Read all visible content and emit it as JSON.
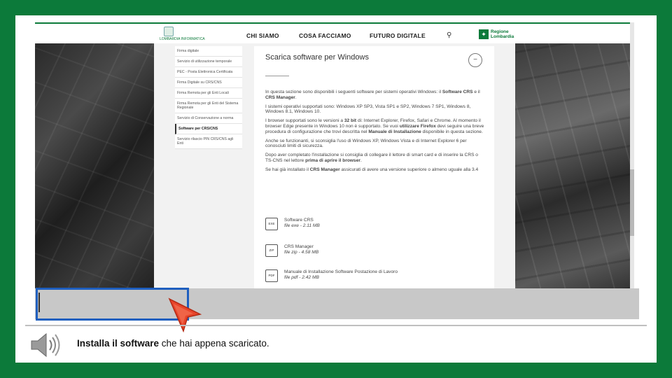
{
  "site": {
    "logo_text": "LOMBARDIA INFORMATICA",
    "nav": [
      "CHI SIAMO",
      "COSA FACCIAMO",
      "FUTURO DIGITALE"
    ],
    "search_icon": "search-icon",
    "region_line1": "Regione",
    "region_line2": "Lombardia"
  },
  "sidebar": {
    "items": [
      {
        "label": "Firma digitale"
      },
      {
        "label": "Servizio di utilizzazione temporale"
      },
      {
        "label": "PEC - Posta Elettronica Certificata"
      },
      {
        "label": "Firma Digitale su CRS/CNS"
      },
      {
        "label": "Firma Remota per gli Enti Locali"
      },
      {
        "label": "Firma Remota per gli Enti del Sistema Regionale"
      },
      {
        "label": "Servizio di Conservazione a norma"
      },
      {
        "label": "Software per CRS/CNS",
        "active": true
      },
      {
        "label": "Servizio rilascio PIN CRS/CNS agli Enti"
      }
    ]
  },
  "content": {
    "title": "Scarica software per Windows",
    "collapse_symbol": "−",
    "p1_a": "In questa sezione sono disponibili i seguenti software per sistemi operativi Windows: il ",
    "p1_b": "Software CRS",
    "p1_c": " e il ",
    "p1_d": "CRS Manager",
    "p1_e": ".",
    "p2": "I sistemi operativi supportati sono: Windows XP SP3, Vista SP1 e SP2, Windows 7 SP1, Windows 8, Windows 8.1, Windows 10.",
    "p3_a": "I browser supportati sono le versioni a ",
    "p3_b": "32 bit",
    "p3_c": " di: Internet Explorer, Firefox, Safari e Chrome. Al momento il browser Edge presente in Windows 10 non è supportato. Se vuoi ",
    "p3_d": "utilizzare Firefox",
    "p3_e": " devi seguire una breve procedura di configurazione che trovi descritta nel ",
    "p3_f": "Manuale di Installazione",
    "p3_g": " disponibile in questa sezione.",
    "p4": "Anche se funzionanti, si sconsiglia l'uso di Windows XP, Windows Vista e di Internet Explorer 6 per conosciuti limiti di sicurezza.",
    "p5_a": "Dopo aver completato l'installazione si consiglia di collegare il lettore di smart card e di inserire la CRS o TS-CNS nel lettore ",
    "p5_b": "prima di aprire il browser",
    "p5_c": ".",
    "p6_a": "Se hai già installato il ",
    "p6_b": "CRS Manager",
    "p6_c": " assicurati di avere una versione superiore o almeno uguale alla 3.4",
    "downloads": [
      {
        "icon": "EXE",
        "name": "Software CRS",
        "meta": "file exe - 2.11 MB"
      },
      {
        "icon": "ZIP",
        "name": "CRS Manager",
        "meta": "file zip - 4.58 MB"
      },
      {
        "icon": "PDF",
        "name": "Manuale di Installazione Software Postazione di Lavoro",
        "meta": "file pdf - 2.42 MB"
      }
    ]
  },
  "caption": {
    "bold": "Installa il software",
    "rest": " che hai appena scaricato."
  },
  "colors": {
    "frame": "#0c7a3a",
    "highlight": "#1f5fbf",
    "cursor": "#e8442a"
  }
}
